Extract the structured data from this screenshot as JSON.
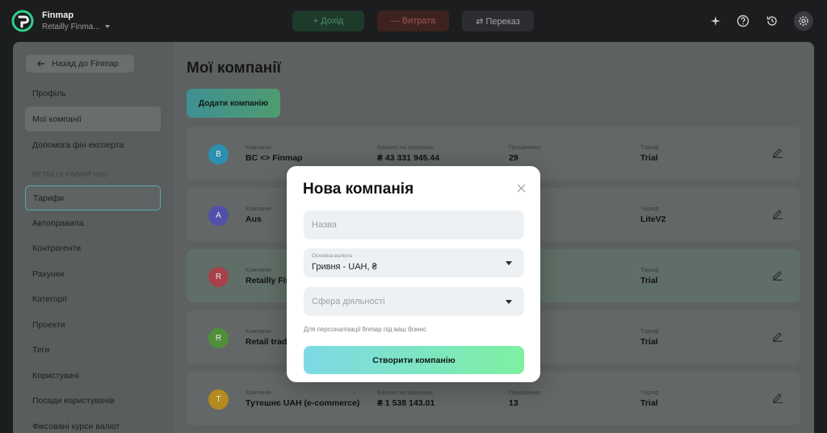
{
  "app": {
    "name": "Finmap",
    "workspace": "Retailly Finma..."
  },
  "topbar": {
    "income_label": "+ Дохід",
    "expense_label": "— Витрата",
    "transfer_label": "⇄ Переказ"
  },
  "sidebar": {
    "back_label": "Назад до Finmap",
    "items_top": [
      "Профіль",
      "Мої компанії",
      "Допомога фін експерта"
    ],
    "section_label": "RETAILLY FINMAP USD",
    "items": [
      "Тарифи",
      "Автоправила",
      "Контрагенти",
      "Рахунки",
      "Категорії",
      "Проекти",
      "Теги",
      "Користувачі",
      "Посади користувачів",
      "Фіксовані курси валют"
    ]
  },
  "main": {
    "title": "Мої компанії",
    "add_button": "Додати компанію",
    "column_labels": {
      "company": "Компанія",
      "balance": "Баланс на рахунках",
      "employees": "Працівники",
      "tariff": "Тариф"
    },
    "companies": [
      {
        "initial": "B",
        "name": "BC <> Finmap",
        "balance": "₴ 43 331 945.44",
        "employees": "29",
        "tariff": "Trial",
        "color": "#2a8fb0"
      },
      {
        "initial": "A",
        "name": "Aus",
        "balance": "",
        "employees": "",
        "tariff": "LiteV2",
        "color": "#4f51a8"
      },
      {
        "initial": "R",
        "name": "Retailly Fin",
        "balance": "",
        "employees": "",
        "tariff": "Trial",
        "color": "#a8414a"
      },
      {
        "initial": "R",
        "name": "Retail trad",
        "balance": "",
        "employees": "",
        "tariff": "Trial",
        "color": "#4f8f3a"
      },
      {
        "initial": "T",
        "name": "Тутешнє UAH (e-commerce)",
        "balance": "₴ 1 538 143.01",
        "employees": "13",
        "tariff": "Trial",
        "color": "#b58a1f"
      }
    ]
  },
  "modal": {
    "title": "Нова компанія",
    "name_placeholder": "Назва",
    "currency_label": "Основна валюта",
    "currency_value": "Гривня - UAH, ₴",
    "industry_placeholder": "Сфера діяльності",
    "hint": "Для персоналізації finmap під ваш бізнес",
    "create_button": "Створити компанію"
  },
  "colors": {
    "accent_start": "#7dd9e6",
    "accent_end": "#7ff0a2",
    "income": "#4f8f6a",
    "expense": "#a2564f"
  }
}
